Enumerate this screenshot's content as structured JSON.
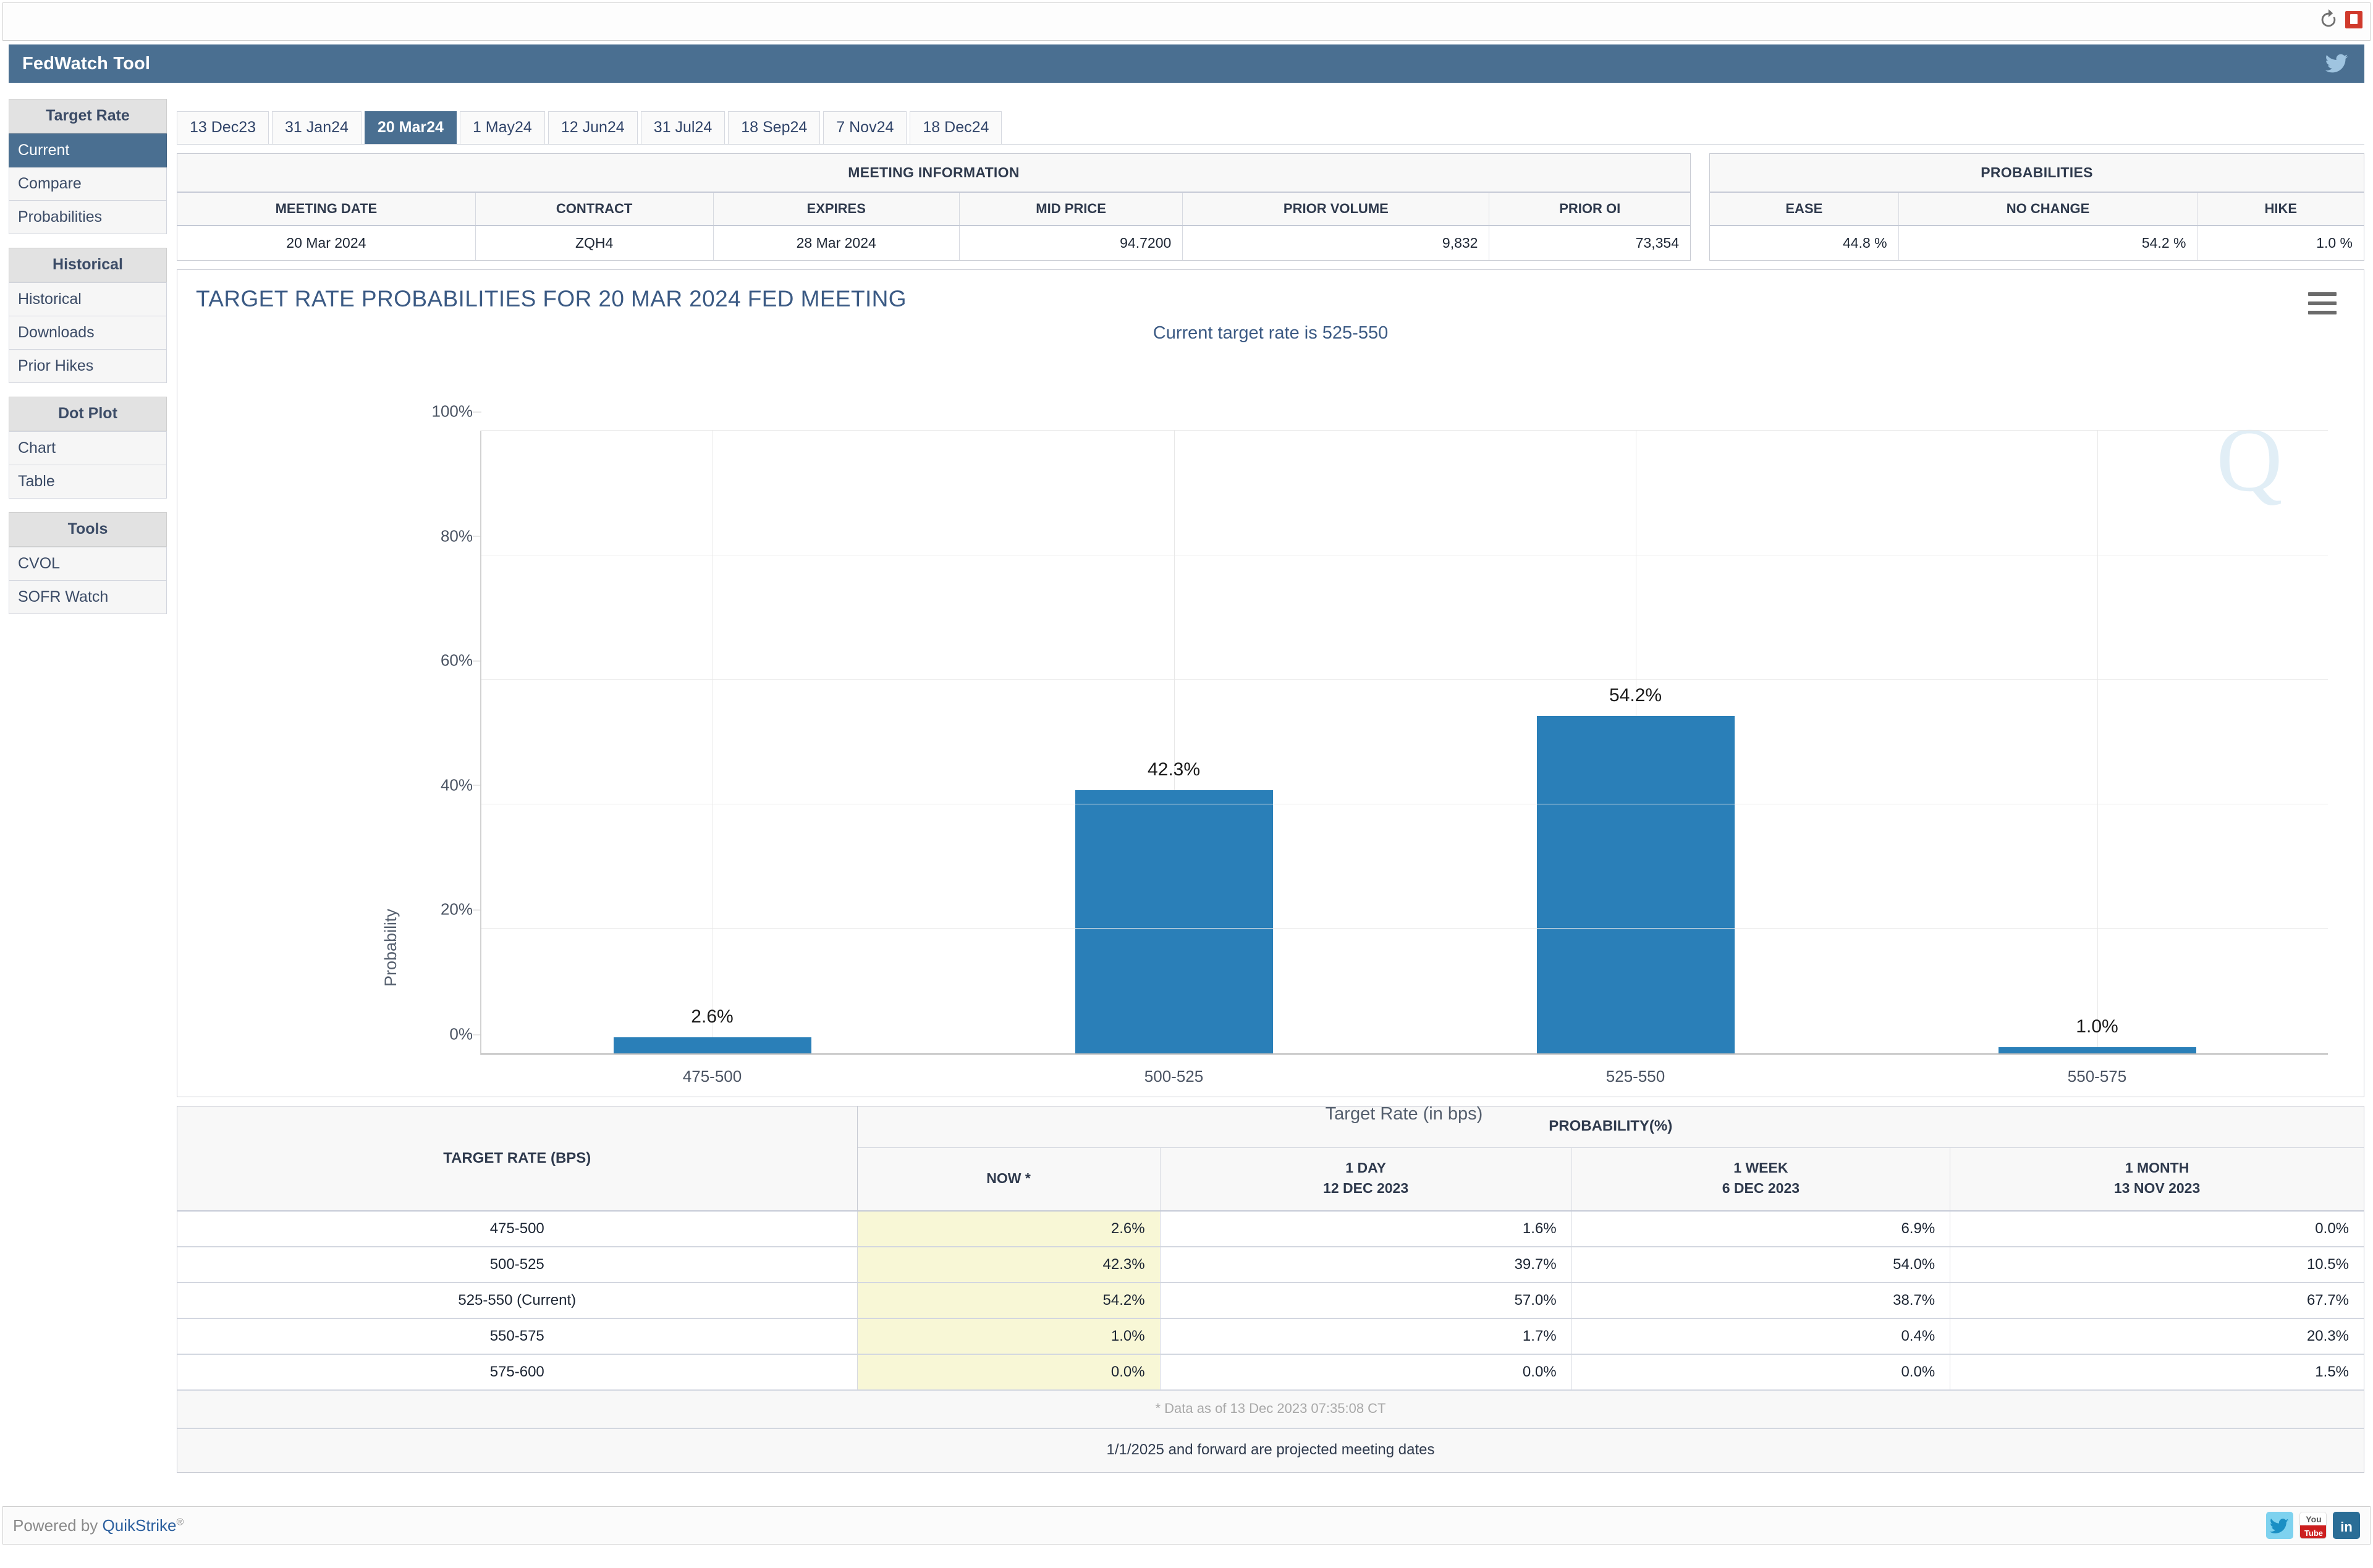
{
  "app": {
    "title": "FedWatch Tool",
    "refresh_icon": "refresh-icon",
    "alert_icon": "alert-icon",
    "twitter_icon": "twitter-bird-icon"
  },
  "sidebar": {
    "groups": [
      {
        "label": "Target Rate",
        "items": [
          {
            "label": "Current",
            "active": true
          },
          {
            "label": "Compare",
            "active": false
          },
          {
            "label": "Probabilities",
            "active": false
          }
        ]
      },
      {
        "label": "Historical",
        "items": [
          {
            "label": "Historical",
            "active": false
          },
          {
            "label": "Downloads",
            "active": false
          },
          {
            "label": "Prior Hikes",
            "active": false
          }
        ]
      },
      {
        "label": "Dot Plot",
        "items": [
          {
            "label": "Chart",
            "active": false
          },
          {
            "label": "Table",
            "active": false
          }
        ]
      },
      {
        "label": "Tools",
        "items": [
          {
            "label": "CVOL",
            "active": false
          },
          {
            "label": "SOFR Watch",
            "active": false
          }
        ]
      }
    ]
  },
  "tabs": [
    {
      "label": "13 Dec23",
      "active": false
    },
    {
      "label": "31 Jan24",
      "active": false
    },
    {
      "label": "20 Mar24",
      "active": true
    },
    {
      "label": "1 May24",
      "active": false
    },
    {
      "label": "12 Jun24",
      "active": false
    },
    {
      "label": "31 Jul24",
      "active": false
    },
    {
      "label": "18 Sep24",
      "active": false
    },
    {
      "label": "7 Nov24",
      "active": false
    },
    {
      "label": "18 Dec24",
      "active": false
    }
  ],
  "meeting_information": {
    "panel_title": "MEETING INFORMATION",
    "headers": [
      "MEETING DATE",
      "CONTRACT",
      "EXPIRES",
      "MID PRICE",
      "PRIOR VOLUME",
      "PRIOR OI"
    ],
    "row": {
      "meeting_date": "20 Mar 2024",
      "contract": "ZQH4",
      "expires": "28 Mar 2024",
      "mid_price": "94.7200",
      "prior_volume": "9,832",
      "prior_oi": "73,354"
    }
  },
  "probabilities_panel": {
    "panel_title": "PROBABILITIES",
    "headers": [
      "EASE",
      "NO CHANGE",
      "HIKE"
    ],
    "row": {
      "ease": "44.8 %",
      "no_change": "54.2 %",
      "hike": "1.0 %"
    }
  },
  "chart_card": {
    "menu_icon": "hamburger-menu-icon",
    "watermark_icon": "quikstrike-q-watermark-icon"
  },
  "chart_data": {
    "type": "bar",
    "title": "TARGET RATE PROBABILITIES FOR 20 MAR 2024 FED MEETING",
    "subtitle": "Current target rate is 525-550",
    "xlabel": "Target Rate (in bps)",
    "ylabel": "Probability",
    "categories": [
      "475-500",
      "500-525",
      "525-550",
      "550-575"
    ],
    "values": [
      2.6,
      42.3,
      54.2,
      1.0
    ],
    "data_labels": [
      "2.6%",
      "42.3%",
      "54.2%",
      "1.0%"
    ],
    "ylim": [
      0,
      100
    ],
    "yticks": [
      0,
      20,
      40,
      60,
      80,
      100
    ],
    "ytick_labels": [
      "0%",
      "20%",
      "40%",
      "60%",
      "80%",
      "100%"
    ],
    "grid": true,
    "legend": "none",
    "bar_color": "#2a7fb8"
  },
  "probability_table": {
    "target_header": "TARGET RATE (BPS)",
    "prob_header": "PROBABILITY(%)",
    "columns": [
      {
        "title": "NOW *",
        "date": ""
      },
      {
        "title": "1 DAY",
        "date": "12 DEC 2023"
      },
      {
        "title": "1 WEEK",
        "date": "6 DEC 2023"
      },
      {
        "title": "1 MONTH",
        "date": "13 NOV 2023"
      }
    ],
    "rows": [
      {
        "label": "475-500",
        "now": "2.6%",
        "day": "1.6%",
        "week": "6.9%",
        "month": "0.0%"
      },
      {
        "label": "500-525",
        "now": "42.3%",
        "day": "39.7%",
        "week": "54.0%",
        "month": "10.5%"
      },
      {
        "label": "525-550 (Current)",
        "now": "54.2%",
        "day": "57.0%",
        "week": "38.7%",
        "month": "67.7%"
      },
      {
        "label": "550-575",
        "now": "1.0%",
        "day": "1.7%",
        "week": "0.4%",
        "month": "20.3%"
      },
      {
        "label": "575-600",
        "now": "0.0%",
        "day": "0.0%",
        "week": "0.0%",
        "month": "1.5%"
      }
    ],
    "footnote": "* Data as of 13 Dec 2023 07:35:08 CT",
    "projection_note": "1/1/2025 and forward are projected meeting dates"
  },
  "footer": {
    "powered_prefix": "Powered by ",
    "powered_brand": "QuikStrike",
    "powered_mark": "®",
    "social": [
      {
        "name": "twitter-icon"
      },
      {
        "name": "youtube-icon"
      },
      {
        "name": "linkedin-icon"
      }
    ]
  }
}
